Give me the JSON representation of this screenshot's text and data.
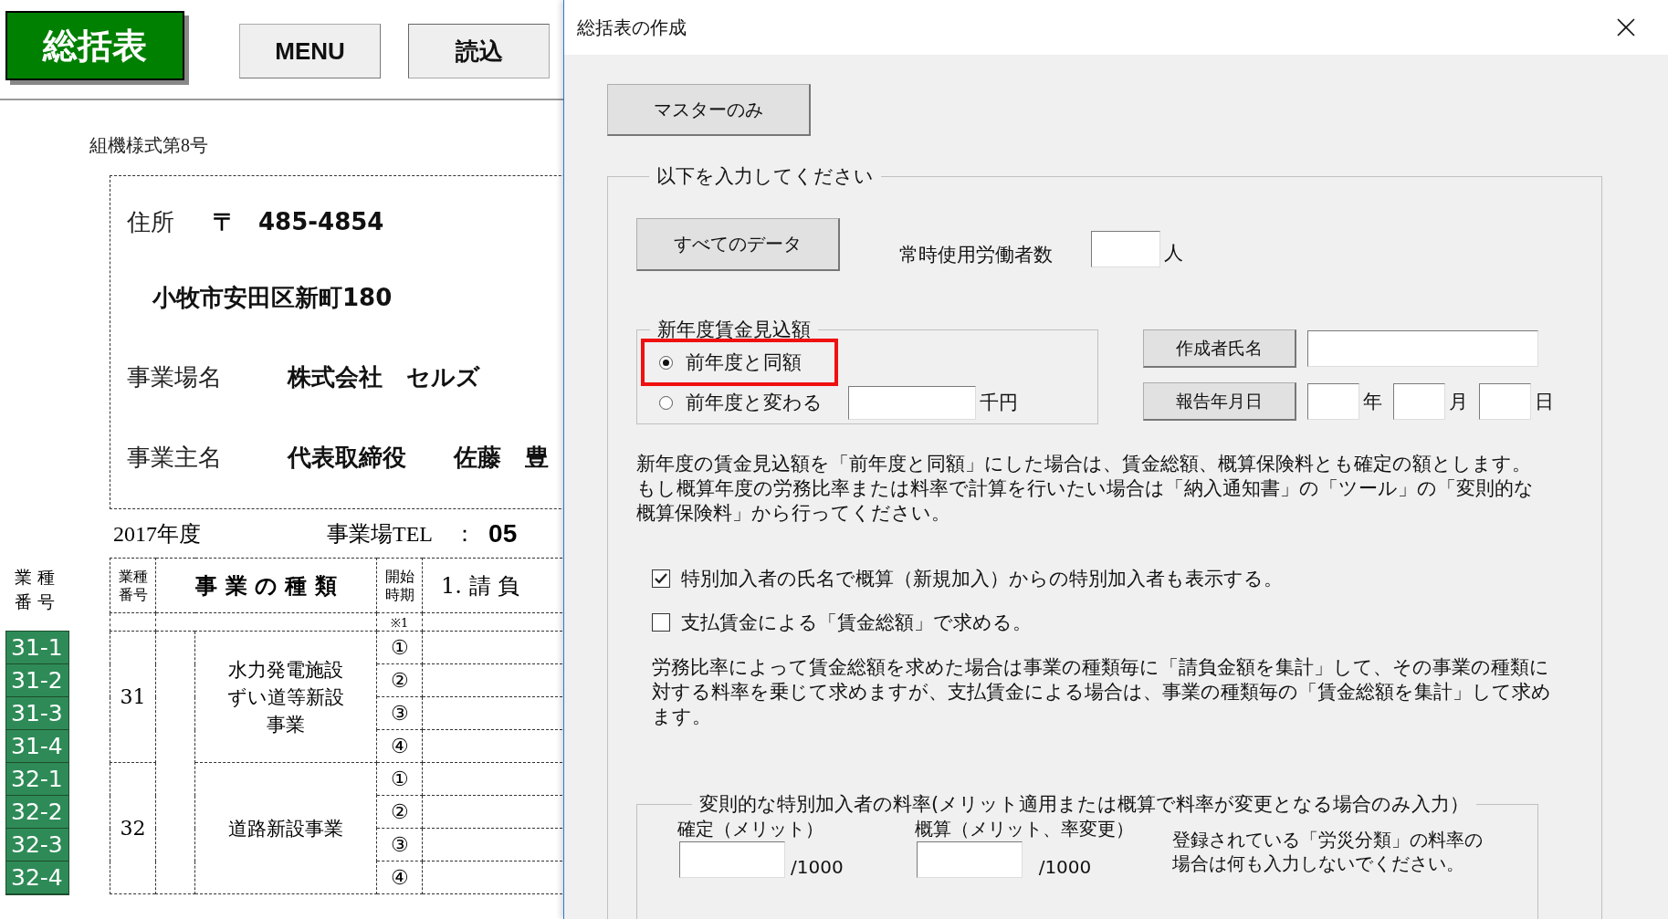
{
  "toolbar": {
    "title_button": "総括表",
    "buttons": [
      "MENU",
      "読込"
    ]
  },
  "sheet": {
    "form_number": "組機様式第8号",
    "address": {
      "label": "住所",
      "postal_mark": "〒",
      "postal_code": "485-4854",
      "line": "小牧市安田区新町180"
    },
    "fields": [
      {
        "label": "事業場名",
        "value": "株式会社　セルズ"
      },
      {
        "label": "事業主名",
        "value": "代表取締役　　佐藤　豊"
      }
    ],
    "fiscal_year": "2017年度",
    "tel_label": "事業場TEL　：",
    "tel_value": "05",
    "side_header": "業種番号",
    "side_codes": [
      "31-1",
      "31-2",
      "31-3",
      "31-4",
      "32-1",
      "32-2",
      "32-3",
      "32-4"
    ],
    "table": {
      "columns": [
        "業種番号",
        "事 業 の 種 類",
        "開始時期",
        "1. 請 負"
      ],
      "note_mark": "※1",
      "groups": [
        {
          "code": "31",
          "name": "水力発電施設ずい道等新設事業",
          "periods": [
            "①",
            "②",
            "③",
            "④"
          ]
        },
        {
          "code": "32",
          "name": "道路新設事業",
          "periods": [
            "①",
            "②",
            "③",
            "④"
          ]
        }
      ]
    }
  },
  "dialog": {
    "title": "総括表の作成",
    "master_button": "マスターのみ",
    "group": {
      "legend": "以下を入力してください",
      "all_data_button": "すべてのデータ",
      "workers": {
        "label": "常時使用労働者数",
        "unit": "人"
      },
      "wage_estimate": {
        "legend": "新年度賃金見込額",
        "options": [
          {
            "label": "前年度と同額",
            "selected": true,
            "highlighted": true
          },
          {
            "label": "前年度と変わる",
            "selected": false,
            "highlighted": false
          }
        ],
        "amount_unit": "千円"
      },
      "author_button": "作成者氏名",
      "report_date_button": "報告年月日",
      "date_units": [
        "年",
        "月",
        "日"
      ],
      "note": "新年度の賃金見込額を「前年度と同額」にした場合は、賃金総額、概算保険料とも確定の額とします。もし概算年度の労務比率または料率で計算を行いたい場合は「納入通知書」の「ツール」の「変則的な概算保険料」から行ってください。",
      "checkboxes": [
        {
          "label": "特別加入者の氏名で概算（新規加入）からの特別加入者も表示する。",
          "checked": true
        },
        {
          "label": "支払賃金による「賃金総額」で求める。",
          "checked": false
        }
      ],
      "note2": "労務比率によって賃金総額を求めた場合は事業の種類毎に「請負金額を集計」して、その事業の種類に対する料率を乗じて求めますが、支払賃金による場合は、事業の種類毎の「賃金総額を集計」して求めます。",
      "special_rates": {
        "legend": "変則的な特別加入者の料率(メリット適用または概算で料率が変更となる場合のみ入力）",
        "fields": [
          {
            "label": "確定（メリット）",
            "unit": "/1000"
          },
          {
            "label": "概算（メリット、率変更）",
            "unit": "/1000"
          }
        ],
        "note": "登録されている「労災分類」の料率の場合は何も入力しないでください。"
      }
    }
  }
}
